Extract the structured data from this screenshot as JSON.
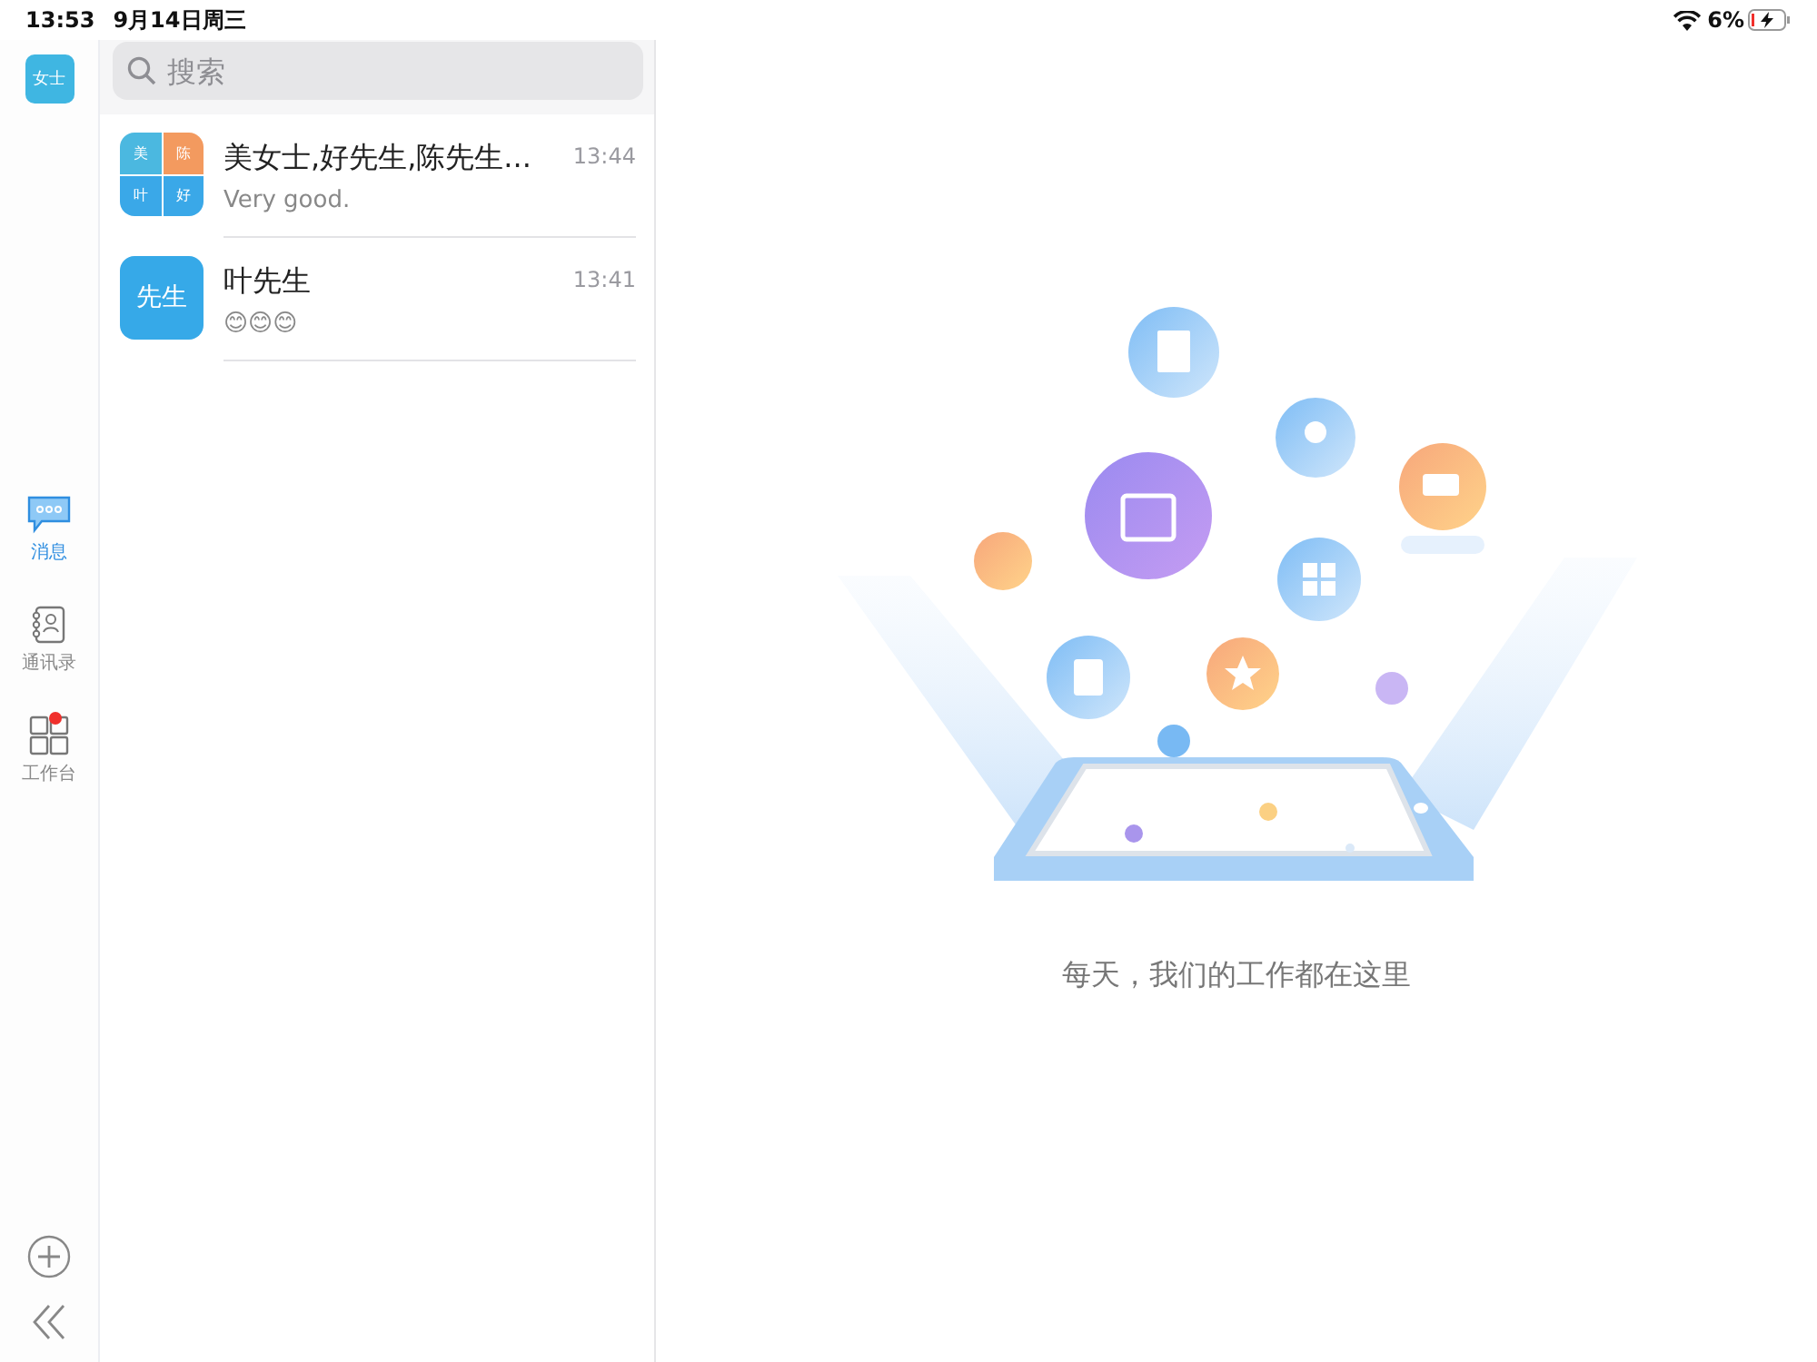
{
  "status_bar": {
    "time": "13:53",
    "date": "9月14日周三",
    "battery": "6%",
    "charging": true
  },
  "profile": {
    "avatar_text": "女士"
  },
  "nav": [
    {
      "kind": "messages",
      "label": "消息",
      "selected": true,
      "badge": false
    },
    {
      "kind": "contacts",
      "label": "通讯录",
      "selected": false,
      "badge": false
    },
    {
      "kind": "workbench",
      "label": "工作台",
      "selected": false,
      "badge": true
    }
  ],
  "search": {
    "placeholder": "搜索"
  },
  "chats": [
    {
      "kind": "group",
      "name": "美女士,好先生,陈先生...",
      "preview": "Very good.",
      "time": "13:44",
      "avatar_tiles": [
        {
          "text": "美",
          "color": "#4bb8e0"
        },
        {
          "text": "陈",
          "color": "#f39a5f"
        },
        {
          "text": "叶",
          "color": "#3aa8e8"
        },
        {
          "text": "好",
          "color": "#3aa8e8"
        }
      ]
    },
    {
      "kind": "single",
      "name": "叶先生",
      "preview": "😊😊😊",
      "time": "13:41",
      "avatar_text": "先生"
    }
  ],
  "empty_state": {
    "caption": "每天，我们的工作都在这里"
  }
}
